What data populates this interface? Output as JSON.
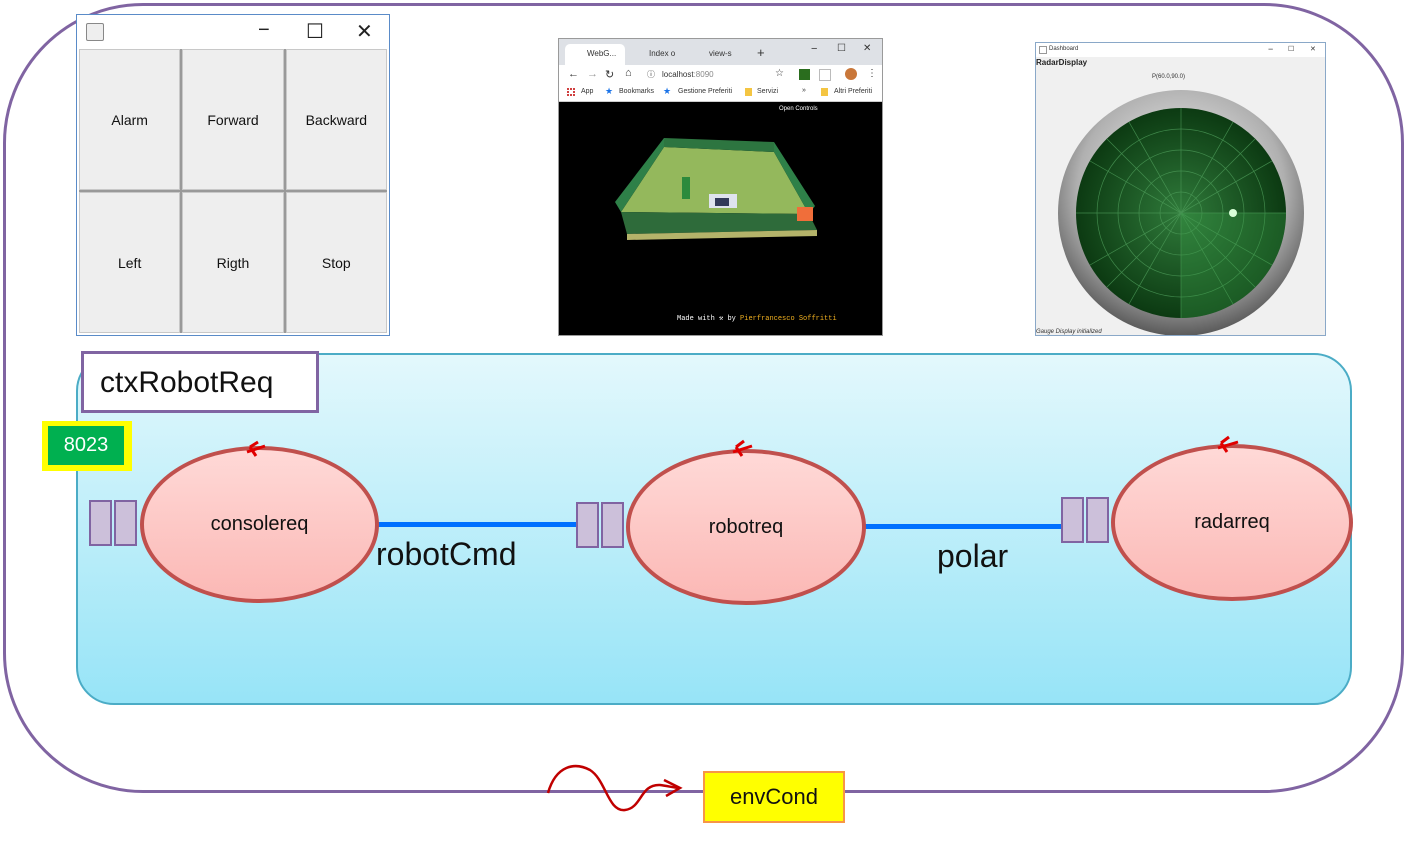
{
  "console_window": {
    "buttons": [
      "Alarm",
      "Forward",
      "Backward",
      "Left",
      "Rigth",
      "Stop"
    ],
    "controls": [
      "−",
      "☐",
      "✕"
    ]
  },
  "browser_window": {
    "tabs": [
      "WebG...",
      "Index o",
      "view-s"
    ],
    "url_host": "localhost",
    "url_port": ":8090",
    "bookmarks": [
      "App",
      "Bookmarks",
      "Gestione Preferiti",
      "Servizi",
      "»",
      "Altri Preferiti"
    ],
    "open_controls": "Open Controls",
    "credit_prefix": "Made with",
    "credit_by": "by",
    "credit_author": "Pierfrancesco Soffritti"
  },
  "radar_window": {
    "title": "Dashboard",
    "header": "RadarDisplay",
    "polar_readout": "P(60.0,90.0)",
    "status": "Gauge Display initialized"
  },
  "diagram": {
    "context_name": "ctxRobotReq",
    "port": "8023",
    "actors": [
      "consolereq",
      "robotreq",
      "radarreq"
    ],
    "links": [
      "robotCmd",
      "polar"
    ],
    "environment": "envCond"
  },
  "colors": {
    "context_border": "#8064a2",
    "actor_border": "#c0504d",
    "link": "#0070ff",
    "port_bg": "#00b050",
    "env_bg": "#ffff00"
  }
}
